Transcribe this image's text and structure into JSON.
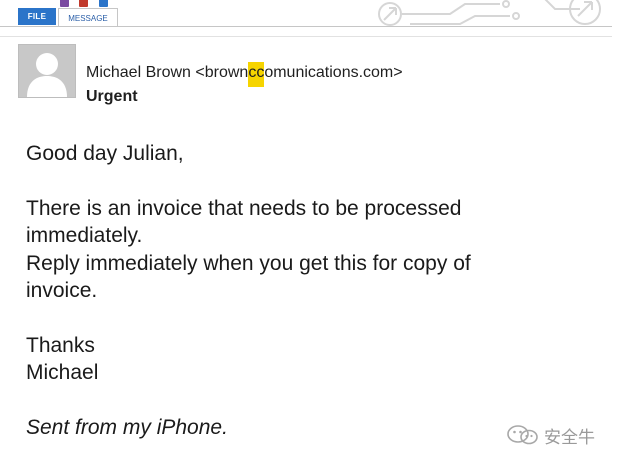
{
  "ribbon": {
    "tabs": [
      {
        "label": "FILE",
        "active": false
      },
      {
        "label": "MESSAGE",
        "active": true
      }
    ]
  },
  "header": {
    "sender_name": "Michael Brown",
    "sender_open": "<",
    "email_prefix": "brown",
    "email_highlight": "cc",
    "email_suffix": "omunications.com",
    "sender_close": ">",
    "subject": "Urgent"
  },
  "body": {
    "greeting": "Good day Julian,",
    "line1": "There is an invoice that needs to be processed",
    "line2": "immediately.",
    "line3": "Reply immediately when you get this for copy of",
    "line4": "invoice.",
    "closing1": "Thanks",
    "closing2": "Michael",
    "signature": "Sent from my iPhone."
  },
  "watermark": {
    "icon": "wechat-icon",
    "text": "安全牛"
  },
  "colors": {
    "file_tab_bg": "#2b74c9",
    "highlight": "#f6d400",
    "avatar_bg": "#c8c8c8"
  }
}
